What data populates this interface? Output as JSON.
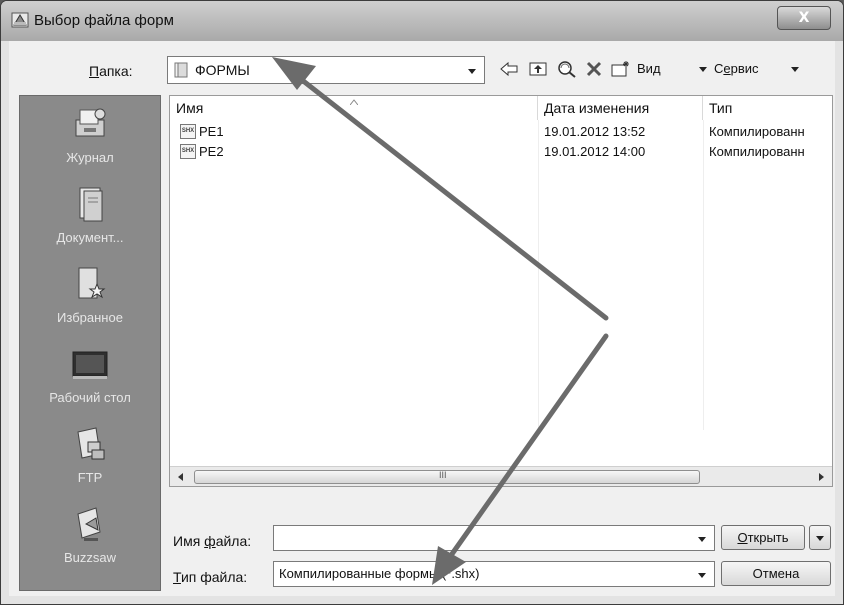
{
  "window": {
    "title": "Выбор файла форм",
    "close_glyph": "X"
  },
  "toolbar": {
    "folder_label_u": "П",
    "folder_label_rest": "апка:",
    "folder_value": "ФОРМЫ",
    "view_label_pre": "Ви",
    "view_label_u": "д",
    "service_label_pre": "С",
    "service_label_u": "е",
    "service_label_rest": "рвис",
    "icons": [
      "back-icon",
      "up-folder-icon",
      "search-web-icon",
      "delete-icon",
      "new-folder-icon"
    ]
  },
  "places": [
    {
      "label": "Журнал",
      "icon": "history-icon"
    },
    {
      "label": "Документ...",
      "icon": "documents-icon"
    },
    {
      "label": "Избранное",
      "icon": "favorites-icon"
    },
    {
      "label": "Рабочий стол",
      "icon": "desktop-icon"
    },
    {
      "label": "FTP",
      "icon": "ftp-icon"
    },
    {
      "label": "Buzzsaw",
      "icon": "buzzsaw-icon"
    }
  ],
  "filelist": {
    "columns": [
      "Имя",
      "Дата изменения",
      "Тип"
    ],
    "rows": [
      {
        "name": "PE1",
        "date": "19.01.2012 13:52",
        "type": "Компилированн"
      },
      {
        "name": "PE2",
        "date": "19.01.2012 14:00",
        "type": "Компилированн"
      }
    ],
    "scroll_grip": "III"
  },
  "filename": {
    "label_pre": "Имя ",
    "label_u": "ф",
    "label_rest": "айла:",
    "value": ""
  },
  "filetype": {
    "label_u": "Т",
    "label_rest": "ип файла:",
    "value": "Компилированные формы (*.shx)"
  },
  "buttons": {
    "open_u": "О",
    "open_rest": "ткрыть",
    "cancel": "Отмена"
  },
  "colors": {
    "arrow": "#6b6b6b",
    "places_bg": "#8a8a8a",
    "titlebar": "#bdbdbd"
  }
}
